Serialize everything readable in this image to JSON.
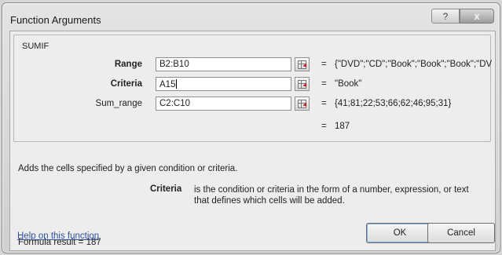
{
  "window": {
    "title": "Function Arguments",
    "help_button": "?",
    "close_button": "x"
  },
  "function": {
    "name": "SUMIF",
    "arguments": [
      {
        "label": "Range",
        "value": "B2:B10",
        "evaluated": "{\"DVD\";\"CD\";\"Book\";\"Book\";\"Book\";\"DVD"
      },
      {
        "label": "Criteria",
        "value": "A15",
        "evaluated": "\"Book\""
      },
      {
        "label": "Sum_range",
        "value": "C2:C10",
        "evaluated": "{41;81;22;53;66;62;46;95;31}"
      }
    ],
    "equals": "=",
    "result_equals": "=",
    "result": "187",
    "description": "Adds the cells specified by a given condition or criteria.",
    "arg_help_name": "Criteria",
    "arg_help_text": "is the condition or criteria in the form of a number, expression, or text that defines which cells will be added."
  },
  "footer": {
    "formula_result_label": "Formula result =",
    "formula_result_value": "187",
    "help_link": "Help on this function",
    "ok_label": "OK",
    "cancel_label": "Cancel"
  }
}
